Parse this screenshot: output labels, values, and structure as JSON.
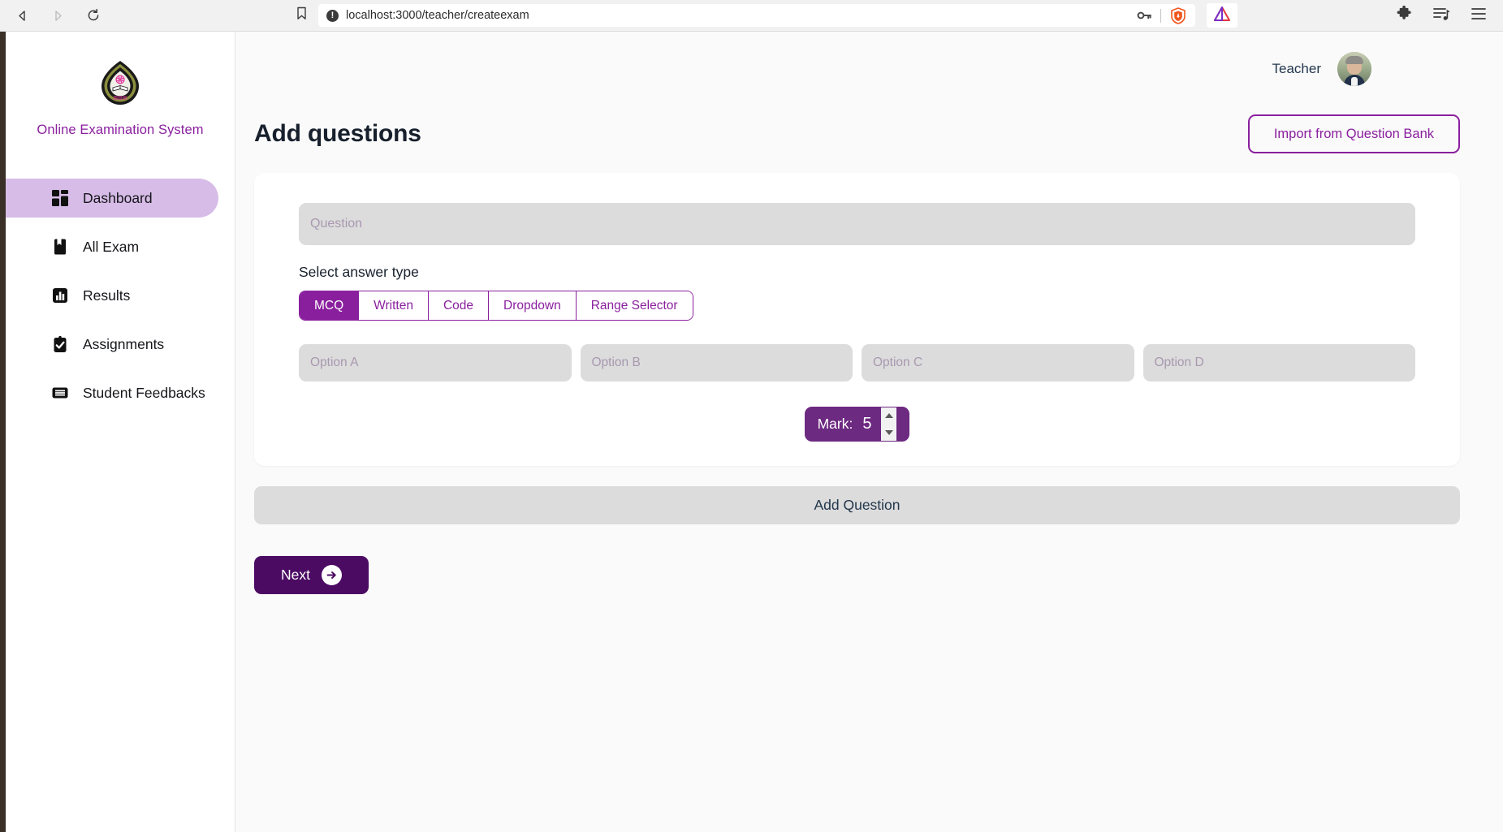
{
  "browser": {
    "back_icon": "back-arrow-icon",
    "forward_icon": "forward-arrow-icon",
    "reload_icon": "reload-icon",
    "bookmark_icon": "bookmark-icon",
    "site_info_icon": "info-icon",
    "url": "localhost:3000/teacher/createexam",
    "password_key_icon": "key-icon",
    "shield_icon": "brave-shield-icon",
    "bat_icon": "bat-triangle-icon",
    "extensions_icon": "puzzle-piece-icon",
    "playlist_icon": "playlist-icon",
    "menu_icon": "hamburger-menu-icon"
  },
  "sidebar": {
    "logo_icon": "university-crest-logo",
    "brand": "Online Examination System",
    "items": [
      {
        "label": "Dashboard",
        "icon": "grid-dashboard-icon",
        "active": true
      },
      {
        "label": "All Exam",
        "icon": "book-icon",
        "active": false
      },
      {
        "label": "Results",
        "icon": "bar-chart-icon",
        "active": false
      },
      {
        "label": "Assignments",
        "icon": "clipboard-check-icon",
        "active": false
      },
      {
        "label": "Student Feedbacks",
        "icon": "feedback-list-icon",
        "active": false
      }
    ]
  },
  "topbar": {
    "role_label": "Teacher",
    "avatar_icon": "user-avatar-photo"
  },
  "header": {
    "title": "Add questions",
    "import_button": "Import from Question Bank"
  },
  "form": {
    "question_placeholder": "Question",
    "question_value": "",
    "select_answer_type_label": "Select answer type",
    "answer_types": [
      {
        "label": "MCQ",
        "active": true
      },
      {
        "label": "Written",
        "active": false
      },
      {
        "label": "Code",
        "active": false
      },
      {
        "label": "Dropdown",
        "active": false
      },
      {
        "label": "Range Selector",
        "active": false
      }
    ],
    "options": [
      {
        "placeholder": "Option A",
        "value": ""
      },
      {
        "placeholder": "Option B",
        "value": ""
      },
      {
        "placeholder": "Option C",
        "value": ""
      },
      {
        "placeholder": "Option D",
        "value": ""
      }
    ],
    "mark_label": "Mark:",
    "mark_value": "5",
    "spinner_icon": "number-spinner-icon"
  },
  "actions": {
    "add_question": "Add Question",
    "next": "Next",
    "next_arrow_icon": "arrow-right-circle-icon"
  },
  "colors": {
    "brand_purple": "#8a1f9e",
    "deep_purple": "#4b0b63",
    "mark_purple": "#6d2a81",
    "active_nav": "#d7bce7",
    "input_gray": "#dcdcdc",
    "page_bg": "#fafafa"
  }
}
